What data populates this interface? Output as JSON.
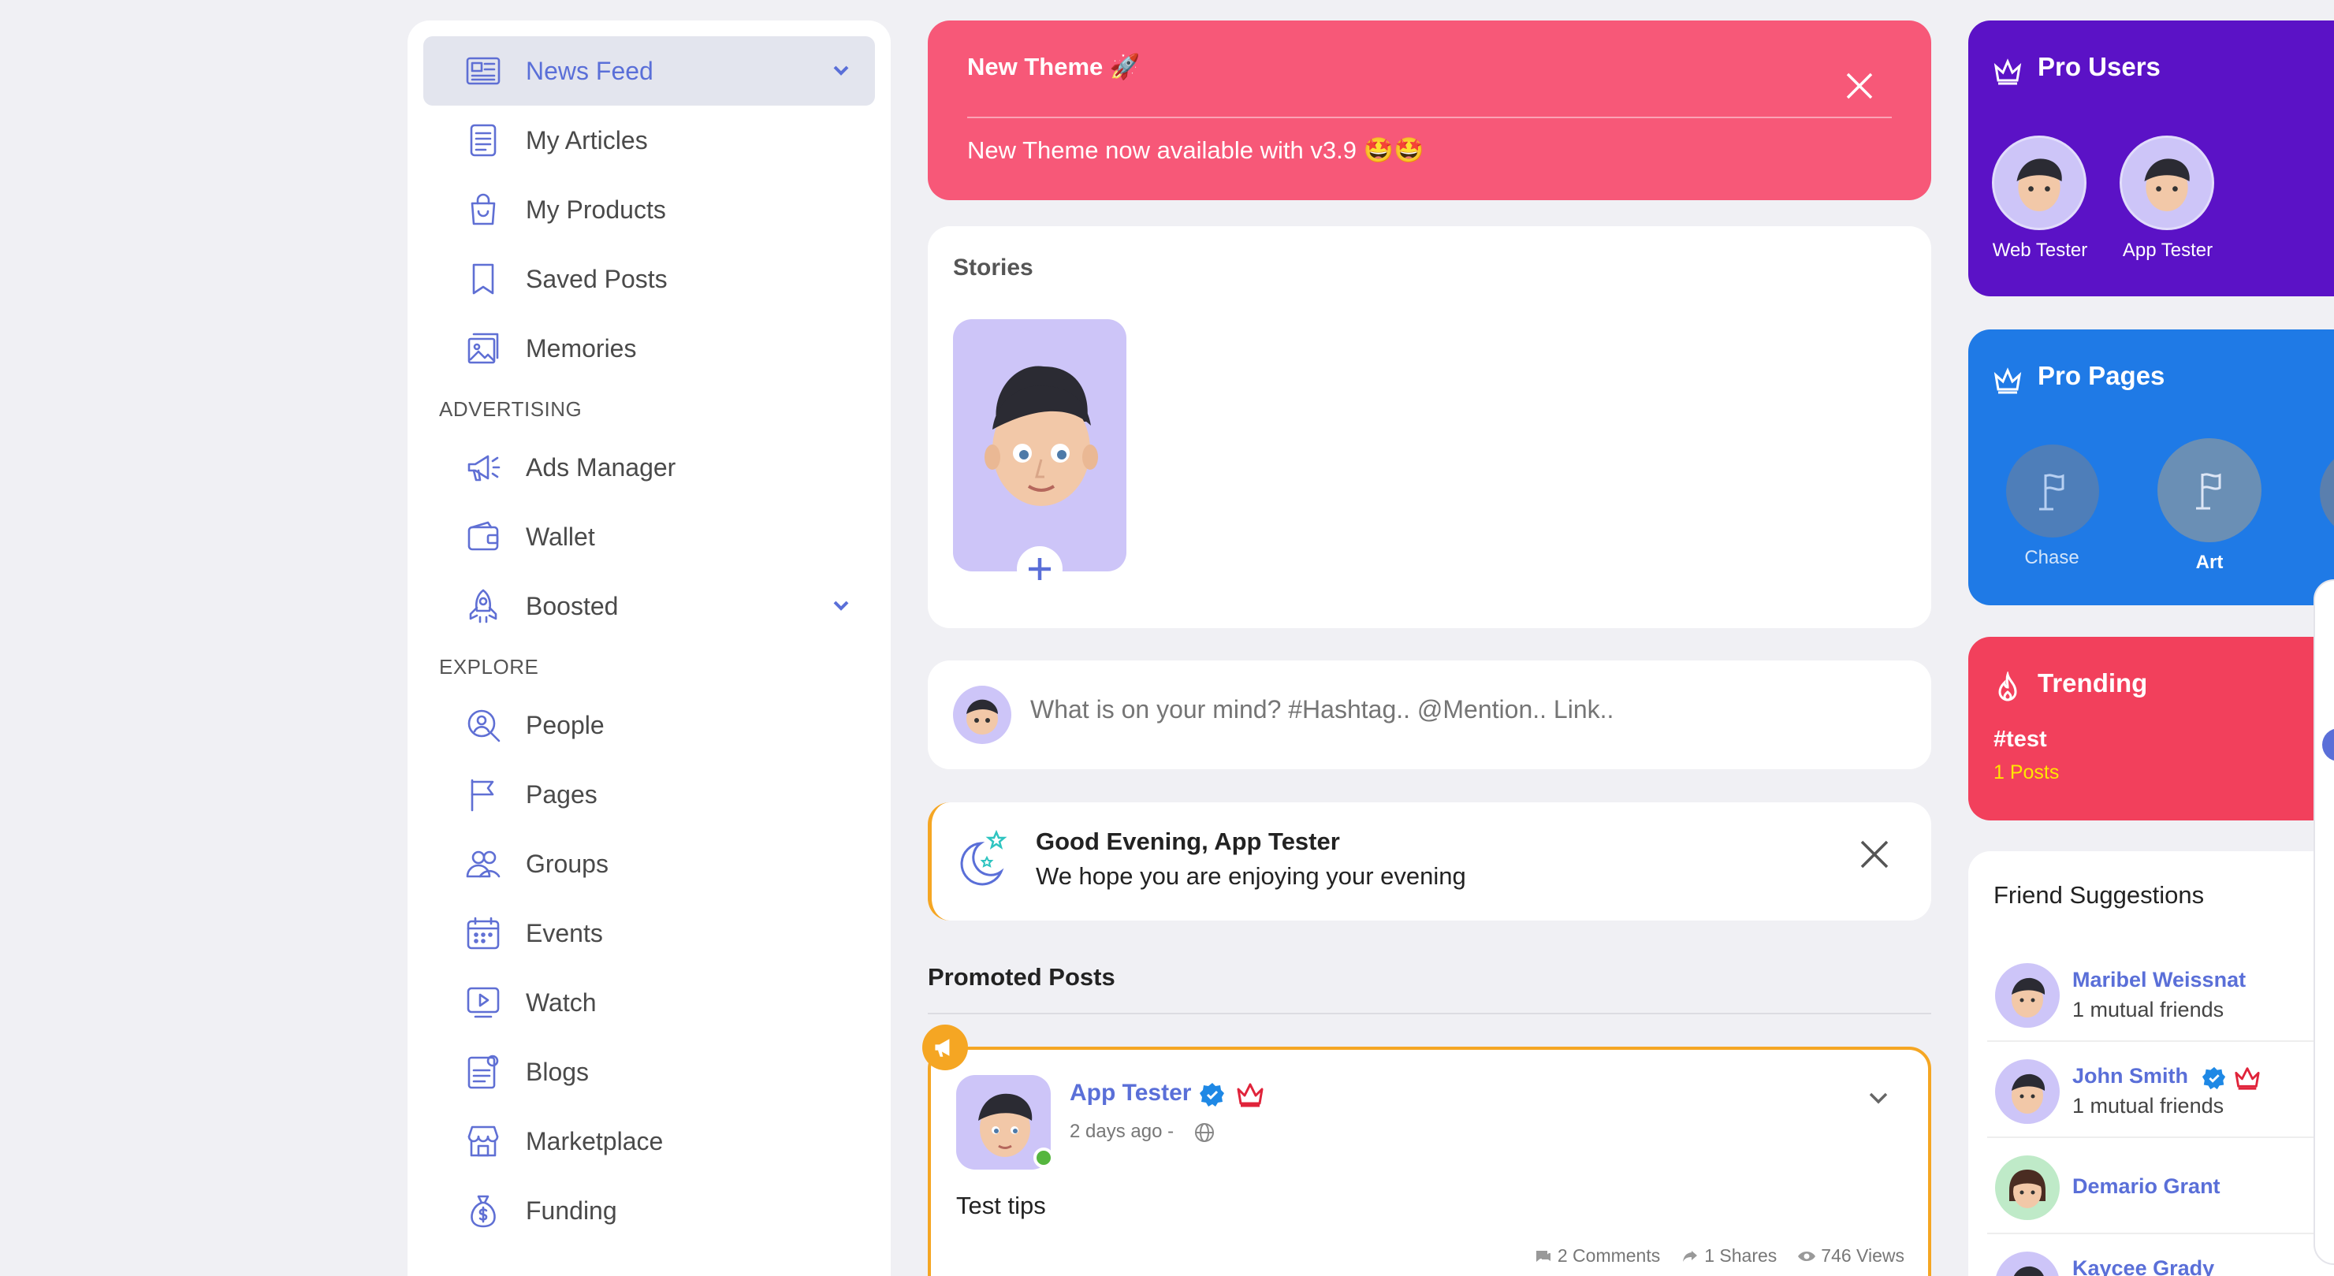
{
  "sidebar": {
    "items": [
      {
        "label": "News Feed",
        "icon": "newspaper-icon",
        "active": true
      },
      {
        "label": "My Articles",
        "icon": "document-icon"
      },
      {
        "label": "My Products",
        "icon": "shopping-bag-icon"
      },
      {
        "label": "Saved Posts",
        "icon": "bookmark-icon"
      },
      {
        "label": "Memories",
        "icon": "photo-stack-icon"
      }
    ],
    "advertising_label": "ADVERTISING",
    "advertising": [
      {
        "label": "Ads Manager",
        "icon": "megaphone-icon"
      },
      {
        "label": "Wallet",
        "icon": "wallet-icon"
      },
      {
        "label": "Boosted",
        "icon": "rocket-icon"
      }
    ],
    "explore_label": "EXPLORE",
    "explore": [
      {
        "label": "People",
        "icon": "person-search-icon"
      },
      {
        "label": "Pages",
        "icon": "flag-icon"
      },
      {
        "label": "Groups",
        "icon": "users-icon"
      },
      {
        "label": "Events",
        "icon": "calendar-icon"
      },
      {
        "label": "Watch",
        "icon": "video-icon"
      },
      {
        "label": "Blogs",
        "icon": "blog-icon"
      },
      {
        "label": "Marketplace",
        "icon": "store-icon"
      },
      {
        "label": "Funding",
        "icon": "money-bag-icon"
      }
    ]
  },
  "banner": {
    "title": "New Theme 🚀",
    "message": "New Theme now available with v3.9 🤩🤩",
    "color": "#f75878"
  },
  "stories": {
    "title": "Stories"
  },
  "composer": {
    "placeholder": "What is on your mind? #Hashtag.. @Mention.. Link.."
  },
  "greeting": {
    "title": "Good Evening, App Tester",
    "subtitle": "We hope you are enjoying your evening"
  },
  "promoted": {
    "heading": "Promoted Posts",
    "post": {
      "author": "App Tester",
      "time": "2 days ago -",
      "text": "Test tips",
      "comments": "2 Comments",
      "shares": "1 Shares",
      "views": "746 Views"
    }
  },
  "pro_users": {
    "title": "Pro Users",
    "users": [
      "Web Tester",
      "App Tester"
    ],
    "color": "#5b12c6"
  },
  "pro_pages": {
    "title": "Pro Pages",
    "pages": [
      "Chase",
      "Art"
    ],
    "color": "#1f7ae6"
  },
  "trending": {
    "title": "Trending",
    "tag": "#test",
    "count": "1 Posts",
    "color": "#f2405c"
  },
  "friends": {
    "title": "Friend Suggestions",
    "list": [
      {
        "name": "Maribel Weissnat",
        "mutual": "1 mutual friends"
      },
      {
        "name": "John Smith",
        "mutual": "1 mutual friends"
      },
      {
        "name": "Demario Grant",
        "mutual": ""
      },
      {
        "name": "Kaycee Grady",
        "mutual": ""
      }
    ]
  },
  "accent": "#5a6fd8"
}
